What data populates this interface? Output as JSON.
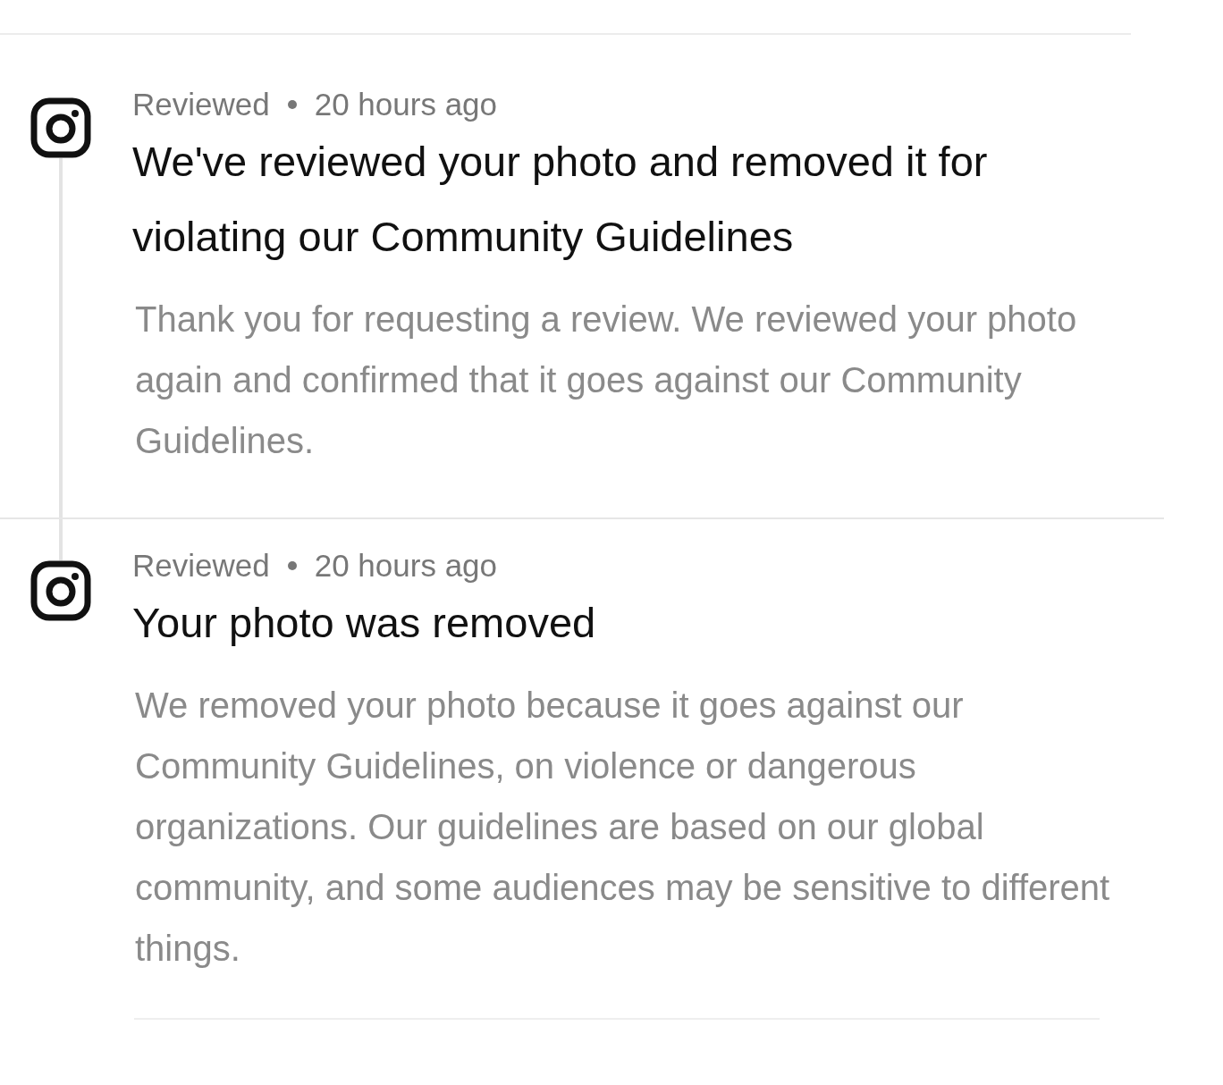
{
  "notifications": [
    {
      "status": "Reviewed",
      "time": "20 hours ago",
      "title": "We've reviewed your photo and removed it for violating our Community Guidelines",
      "body": "Thank you for requesting a review. We reviewed your photo again and confirmed that it goes against our Community Guidelines."
    },
    {
      "status": "Reviewed",
      "time": "20 hours ago",
      "title": "Your photo was removed",
      "body": "We removed your photo because it goes against our Community Guidelines, on violence or dangerous organizations. Our guidelines are based on our global community, and some audiences may be sensitive to different things."
    }
  ]
}
